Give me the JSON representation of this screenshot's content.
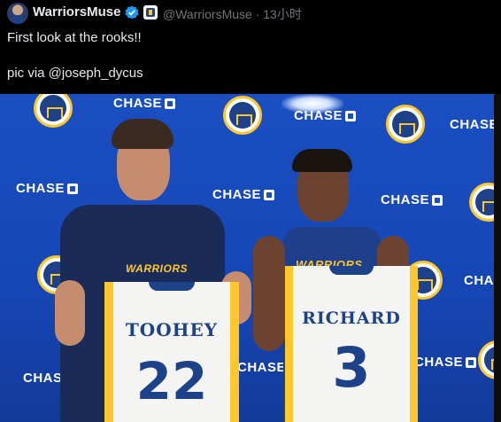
{
  "tweet": {
    "display_name": "WarriorsMuse",
    "handle": "@WarriorsMuse",
    "separator": "·",
    "time": "13小时",
    "text": "First look at the rooks!!\n\npic via @joseph_dycus"
  },
  "photo": {
    "backdrop_logo_text": "CHASE",
    "shirt_text": "WARRIORS",
    "tank_text": "WARRIORS",
    "jersey_left": {
      "name": "TOOHEY",
      "number": "22"
    },
    "jersey_right": {
      "name": "RICHARD",
      "number": "3"
    },
    "colors": {
      "backdrop": "#1a4fc2",
      "navy": "#1d428a",
      "gold": "#ffc72c"
    }
  }
}
